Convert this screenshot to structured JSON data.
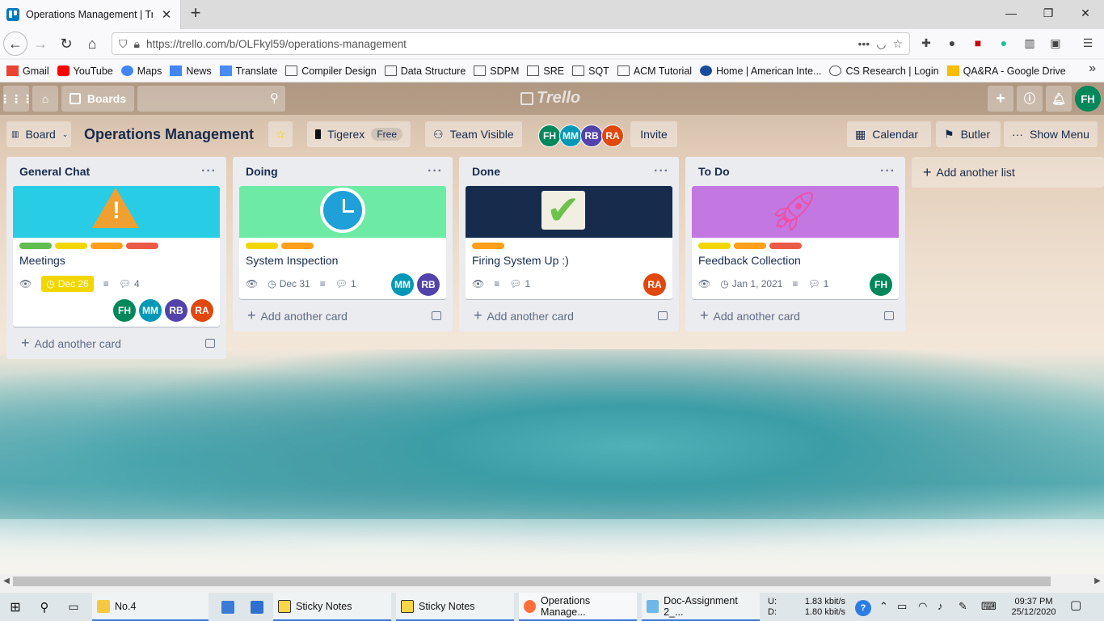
{
  "browser": {
    "tab_title": "Operations Management | Trello",
    "url": "https://trello.com/b/OLFkyl59/operations-management",
    "bookmarks": [
      "Gmail",
      "YouTube",
      "Maps",
      "News",
      "Translate",
      "Compiler Design",
      "Data Structure",
      "SDPM",
      "SRE",
      "SQT",
      "ACM Tutorial",
      "Home | American Inte...",
      "CS Research | Login",
      "QA&RA - Google Drive"
    ]
  },
  "header": {
    "boards_label": "Boards",
    "logo": "Trello",
    "user_initials": "FH"
  },
  "boardbar": {
    "view_label": "Board",
    "title": "Operations Management",
    "team": "Tigerex",
    "plan": "Free",
    "visibility": "Team Visible",
    "members": [
      "FH",
      "MM",
      "RB",
      "RA"
    ],
    "invite": "Invite",
    "calendar": "Calendar",
    "butler": "Butler",
    "show_menu": "Show Menu"
  },
  "lists": [
    {
      "title": "General Chat",
      "card": {
        "title": "Meetings",
        "due": "Dec 26",
        "comments": "4",
        "members": [
          "FH",
          "MM",
          "RB",
          "RA"
        ]
      },
      "add_card": "Add another card"
    },
    {
      "title": "Doing",
      "card": {
        "title": "System Inspection",
        "due": "Dec 31",
        "comments": "1",
        "members": [
          "MM",
          "RB"
        ]
      },
      "add_card": "Add another card"
    },
    {
      "title": "Done",
      "card": {
        "title": "Firing System Up :)",
        "comments": "1",
        "members": [
          "RA"
        ]
      },
      "add_card": "Add another card"
    },
    {
      "title": "To Do",
      "card": {
        "title": "Feedback Collection",
        "due": "Jan 1, 2021",
        "comments": "1",
        "members": [
          "FH"
        ]
      },
      "add_card": "Add another card"
    }
  ],
  "add_list": "Add another list",
  "colors": {
    "FH": "#00875a",
    "MM": "#0098b7",
    "RB": "#5243aa",
    "RA": "#e0480e",
    "label_green": "#61bd4f",
    "label_yellow": "#f2d600",
    "label_orange": "#ff9f1a",
    "label_red": "#eb5a46"
  },
  "taskbar": {
    "items": [
      "No.4",
      "Sticky Notes",
      "Sticky Notes",
      "Operations Manage...",
      "Doc-Assignment 2_..."
    ],
    "net_up_label": "U:",
    "net_down_label": "D:",
    "net_up": "1.83 kbit/s",
    "net_down": "1.80 kbit/s",
    "time": "09:37 PM",
    "date": "25/12/2020"
  }
}
